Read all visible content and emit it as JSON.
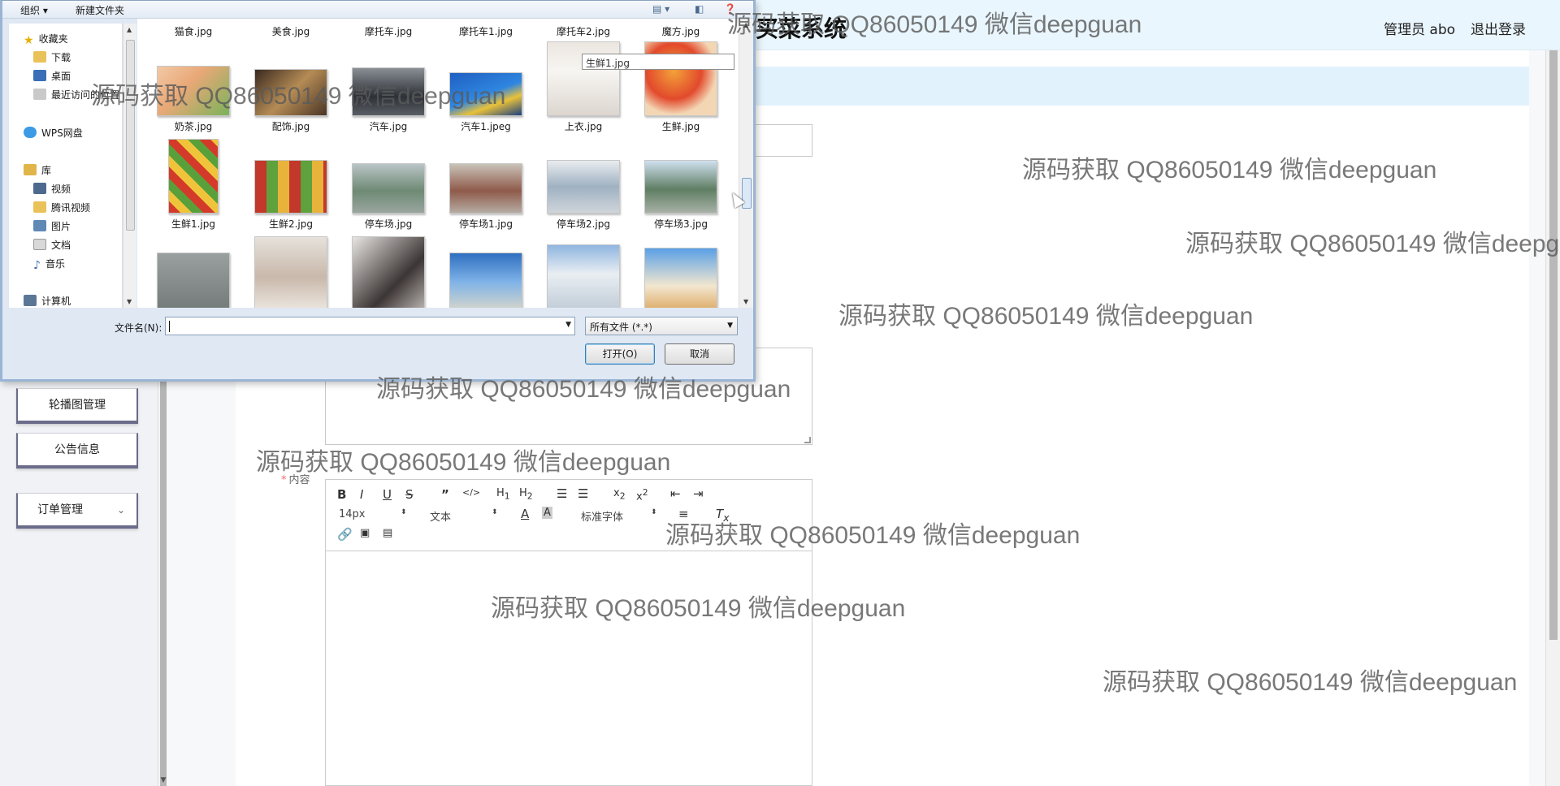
{
  "app": {
    "title": "买菜系统",
    "user_label": "管理员 abo",
    "logout_label": "退出登录",
    "sidebar": [
      {
        "label": "轮播图管理"
      },
      {
        "label": "公告信息"
      },
      {
        "label": "订单管理"
      }
    ],
    "form": {
      "content_label": "内容",
      "required_mark": "*"
    },
    "editor": {
      "font_size": "14px",
      "block_type": "文本",
      "font_family": "标准字体"
    }
  },
  "dialog": {
    "toolbar": {
      "organize": "组织 ▾",
      "new_folder": "新建文件夹"
    },
    "nav": [
      {
        "label": "收藏夹",
        "icon": "star-icon"
      },
      {
        "label": "下载",
        "icon": "download-folder-icon"
      },
      {
        "label": "桌面",
        "icon": "desktop-icon"
      },
      {
        "label": "最近访问的位置",
        "icon": "recent-places-icon"
      },
      {
        "label": "WPS网盘",
        "icon": "cloud-icon"
      },
      {
        "label": "库",
        "icon": "library-icon"
      },
      {
        "label": "视频",
        "icon": "video-icon"
      },
      {
        "label": "腾讯视频",
        "icon": "folder-icon"
      },
      {
        "label": "图片",
        "icon": "pictures-icon"
      },
      {
        "label": "文档",
        "icon": "documents-icon"
      },
      {
        "label": "音乐",
        "icon": "music-icon"
      },
      {
        "label": "计算机",
        "icon": "computer-icon"
      }
    ],
    "files_row0": [
      "猫食.jpg",
      "美食.jpg",
      "摩托车.jpg",
      "摩托车1.jpg",
      "摩托车2.jpg",
      "魔方.jpg"
    ],
    "files_row1": [
      "奶茶.jpg",
      "配饰.jpg",
      "汽车.jpg",
      "汽车1.jpeg",
      "上衣.jpg",
      "生鲜.jpg"
    ],
    "files_row2": [
      "生鲜1.jpg",
      "生鲜2.jpg",
      "停车场.jpg",
      "停车场1.jpg",
      "停车场2.jpg",
      "停车场3.jpg"
    ],
    "tooltip": "生鲜1.jpg",
    "filename_label": "文件名(N):",
    "filename_value": "",
    "filetype_value": "所有文件 (*.*)",
    "open_button": "打开(O)",
    "cancel_button": "取消"
  },
  "watermark": "源码获取 QQ86050149 微信deepguan",
  "colors": {
    "header_bg": "#eaf6fd",
    "band_bg": "#e2f2fd",
    "sidebar_border": "#6b6b8a",
    "dialog_bg": "#dfe8f3"
  }
}
